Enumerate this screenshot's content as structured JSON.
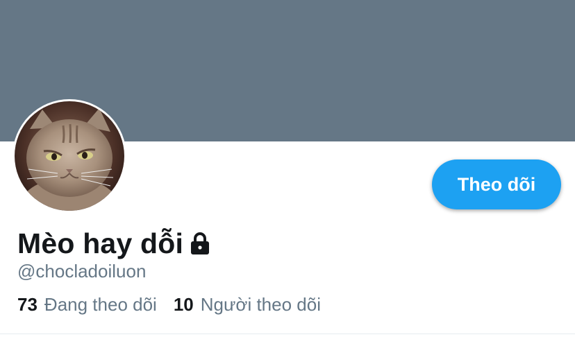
{
  "profile": {
    "display_name": "Mèo hay dỗi",
    "handle": "@chocladoiluon",
    "follow_button_label": "Theo dõi",
    "following_count": "73",
    "following_label": "Đang theo dõi",
    "followers_count": "10",
    "followers_label": "Người theo dõi"
  },
  "icons": {
    "lock": "lock-icon",
    "avatar": "cat-photo"
  },
  "colors": {
    "banner": "#657786",
    "accent": "#1da1f2",
    "text_primary": "#14171a",
    "text_secondary": "#657786"
  }
}
